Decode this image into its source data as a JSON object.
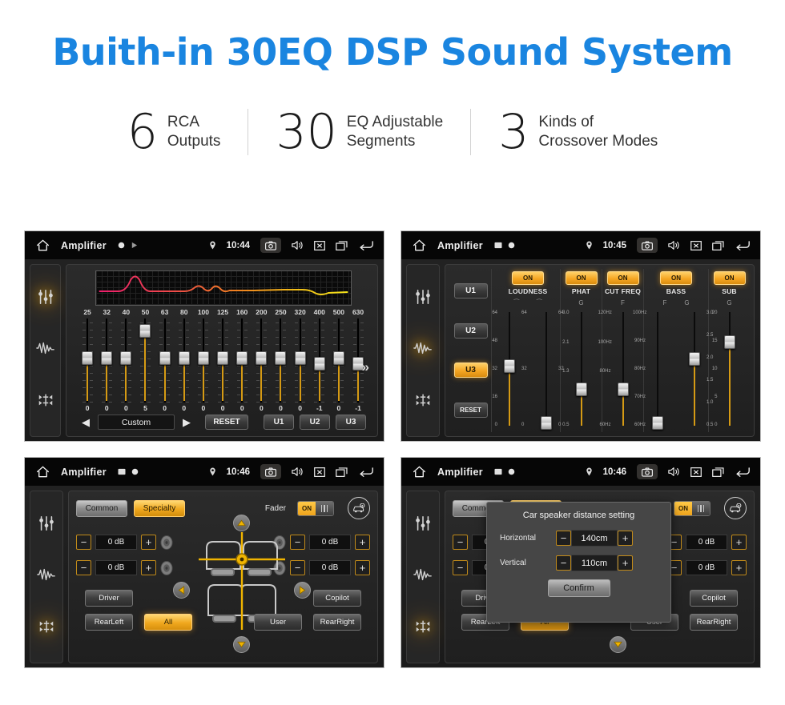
{
  "hero": {
    "title": "Buith-in 30EQ DSP Sound System"
  },
  "stats": [
    {
      "number": "6",
      "line1": "RCA",
      "line2": "Outputs"
    },
    {
      "number": "30",
      "line1": "EQ Adjustable",
      "line2": "Segments"
    },
    {
      "number": "3",
      "line1": "Kinds of",
      "line2": "Crossover Modes"
    }
  ],
  "colors": {
    "title_blue": "#1A85E0",
    "accent_amber": "#f0a81e",
    "panel_bg": "#242424",
    "statusbar_bg": "#060606"
  },
  "statusbar": {
    "app_title": "Amplifier",
    "times": [
      "10:44",
      "10:45",
      "10:46",
      "10:46"
    ],
    "icons": [
      "home-icon",
      "location-icon",
      "screenshot-icon",
      "volume-icon",
      "close-icon",
      "recents-icon",
      "back-icon"
    ]
  },
  "sidebar": {
    "items": [
      {
        "name": "equalizer-icon",
        "label": "Equalizer"
      },
      {
        "name": "waveform-icon",
        "label": "Sound Effect"
      },
      {
        "name": "balance-icon",
        "label": "Balance Fader"
      }
    ],
    "active_index": [
      0,
      1,
      2,
      2
    ]
  },
  "panel_eq": {
    "frequencies": [
      "25",
      "32",
      "40",
      "50",
      "63",
      "80",
      "100",
      "125",
      "160",
      "200",
      "250",
      "320",
      "400",
      "500",
      "630"
    ],
    "values": [
      "0",
      "0",
      "0",
      "5",
      "0",
      "0",
      "0",
      "0",
      "0",
      "0",
      "0",
      "0",
      "-1",
      "0",
      "-1"
    ],
    "values_num": [
      0,
      0,
      0,
      5,
      0,
      0,
      0,
      0,
      0,
      0,
      0,
      0,
      -1,
      0,
      -1
    ],
    "more_icon": "»",
    "prev_arrow": "◀",
    "next_arrow": "▶",
    "preset": "Custom",
    "reset_label": "RESET",
    "user_presets": [
      "U1",
      "U2",
      "U3"
    ],
    "graph": {
      "gradient_from": "#e8216b",
      "gradient_mid": "#f07820",
      "gradient_to": "#f5e51a"
    }
  },
  "panel_dsp": {
    "user_buttons": [
      "U1",
      "U2",
      "U3"
    ],
    "selected_user": "U3",
    "reset_label": "RESET",
    "columns": [
      {
        "label": "LOUDNESS",
        "state": "ON",
        "sub_labels": [
          "⁀",
          "⁀"
        ],
        "sliders": [
          {
            "scale_left": [
              "64",
              "48",
              "32",
              "16",
              "0"
            ],
            "scale_right": [
              "64",
              "",
              "32",
              "",
              "0"
            ],
            "value_pct": 52
          },
          {
            "scale_left": [],
            "scale_right": [
              "64",
              "",
              "32",
              "",
              "0"
            ],
            "value_pct": 5
          }
        ]
      },
      {
        "label": "PHAT",
        "state": "ON",
        "sub_labels": [
          "G"
        ],
        "sliders": [
          {
            "scale_left": [
              "3.0",
              "2.1",
              "1.3",
              "",
              "0.5"
            ],
            "scale_right": [],
            "value_pct": 33
          }
        ]
      },
      {
        "label": "CUT FREQ",
        "state": "ON",
        "sub_labels": [
          "F"
        ],
        "sliders": [
          {
            "scale_left": [
              "120Hz",
              "100Hz",
              "80Hz",
              "",
              "60Hz"
            ],
            "scale_right": [],
            "value_pct": 33
          }
        ]
      },
      {
        "label": "BASS",
        "state": "ON",
        "sub_labels": [
          "F",
          "G"
        ],
        "sliders": [
          {
            "scale_left": [
              "100Hz",
              "90Hz",
              "80Hz",
              "70Hz",
              "60Hz"
            ],
            "scale_right": [],
            "value_pct": 5
          },
          {
            "scale_left": [],
            "scale_right": [
              "3.0",
              "2.5",
              "2.0",
              "1.5",
              "1.0",
              "0.5"
            ],
            "value_pct": 58
          }
        ]
      },
      {
        "label": "SUB",
        "state": "ON",
        "sub_labels": [
          "G"
        ],
        "sliders": [
          {
            "scale_left": [
              "20",
              "15",
              "10",
              "5",
              "0"
            ],
            "scale_right": [],
            "value_pct": 72
          }
        ]
      }
    ]
  },
  "panel_fader": {
    "tabs": [
      "Common",
      "Specialty"
    ],
    "selected_tab": "Specialty",
    "fader_label": "Fader",
    "fader_state": "ON",
    "car_setting_icon": "car-settings-icon",
    "gains": [
      {
        "position": "front-left",
        "value": "0 dB"
      },
      {
        "position": "front-right",
        "value": "0 dB"
      },
      {
        "position": "rear-left",
        "value": "0 dB"
      },
      {
        "position": "rear-right",
        "value": "0 dB"
      }
    ],
    "minus_label": "−",
    "plus_label": "+",
    "preset_buttons": [
      "Driver",
      "Copilot",
      "RearLeft",
      "All",
      "User",
      "RearRight"
    ],
    "selected_preset": "All",
    "direction_icons": [
      "up-arrow-icon",
      "down-arrow-icon",
      "left-arrow-icon",
      "right-arrow-icon"
    ]
  },
  "dialog": {
    "title": "Car speaker distance setting",
    "rows": [
      {
        "label": "Horizontal",
        "value": "140cm"
      },
      {
        "label": "Vertical",
        "value": "110cm"
      }
    ],
    "minus_label": "−",
    "plus_label": "+",
    "confirm_label": "Confirm"
  }
}
